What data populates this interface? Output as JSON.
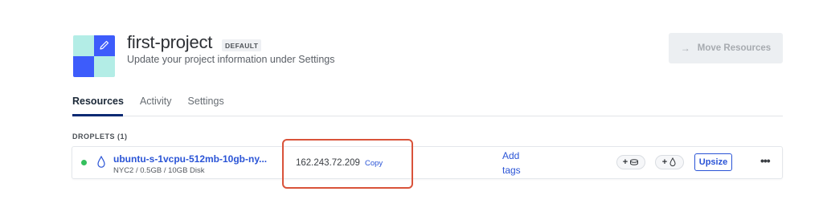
{
  "project": {
    "name": "first-project",
    "badge": "DEFAULT",
    "subtitle": "Update your project information under Settings",
    "logo_colors": {
      "light": "#b3ede6",
      "dark": "#3d5cfb"
    }
  },
  "header_actions": {
    "move_resources_label": "Move Resources",
    "move_resources_icon": "arrow-right-icon",
    "move_resources_disabled": true
  },
  "tabs": [
    {
      "label": "Resources",
      "active": true
    },
    {
      "label": "Activity",
      "active": false
    },
    {
      "label": "Settings",
      "active": false
    }
  ],
  "droplets_section": {
    "label": "DROPLETS (1)",
    "items": [
      {
        "status": "active",
        "status_color": "#34c05d",
        "name": "ubuntu-s-1vcpu-512mb-10gb-ny...",
        "meta": "NYC2 / 0.5GB / 10GB Disk",
        "ip": "162.243.72.209",
        "copy_label": "Copy",
        "add_tags_label": "Add tags",
        "add_volume_label": "+",
        "add_floating_ip_label": "+",
        "upsize_label": "Upsize",
        "more_label": "•••"
      }
    ]
  },
  "colors": {
    "accent": "#2a54d6",
    "highlight": "#d9533a",
    "tab_underline": "#0a2a73"
  }
}
